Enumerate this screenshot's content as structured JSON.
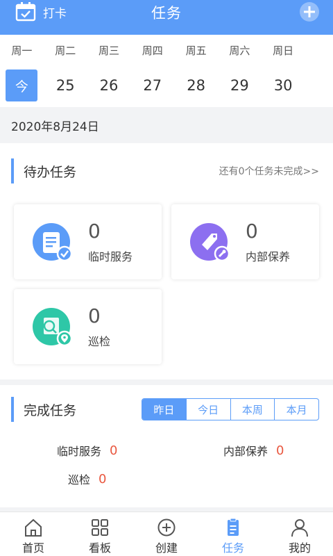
{
  "header": {
    "checkin_label": "打卡",
    "title": "任务"
  },
  "week": {
    "day_names": [
      "周一",
      "周二",
      "周三",
      "周四",
      "周五",
      "周六",
      "周日"
    ],
    "dates": [
      "今",
      "25",
      "26",
      "27",
      "28",
      "29",
      "30"
    ],
    "selected_index": 0
  },
  "date_banner": "2020年8月24日",
  "pending": {
    "title": "待办任务",
    "more_link": "还有0个任务未完成>>",
    "cards": [
      {
        "count": "0",
        "name": "临时服务",
        "icon": "temporary-service-icon"
      },
      {
        "count": "0",
        "name": "内部保养",
        "icon": "internal-maintenance-icon"
      },
      {
        "count": "0",
        "name": "巡检",
        "icon": "inspection-icon"
      }
    ]
  },
  "completed": {
    "title": "完成任务",
    "tabs": [
      "昨日",
      "今日",
      "本周",
      "本月"
    ],
    "active_tab": 0,
    "stats": [
      {
        "label": "临时服务",
        "value": "0"
      },
      {
        "label": "内部保养",
        "value": "0"
      },
      {
        "label": "巡检",
        "value": "0"
      }
    ]
  },
  "nav": {
    "items": [
      {
        "label": "首页",
        "icon": "home-icon"
      },
      {
        "label": "看板",
        "icon": "dashboard-icon"
      },
      {
        "label": "创建",
        "icon": "create-icon"
      },
      {
        "label": "任务",
        "icon": "task-icon"
      },
      {
        "label": "我的",
        "icon": "profile-icon"
      }
    ],
    "active_index": 3
  },
  "colors": {
    "accent": "#5b9cf8",
    "value_red": "#e9573f",
    "purple": "#8c6ff0",
    "teal": "#2ec7a7"
  }
}
